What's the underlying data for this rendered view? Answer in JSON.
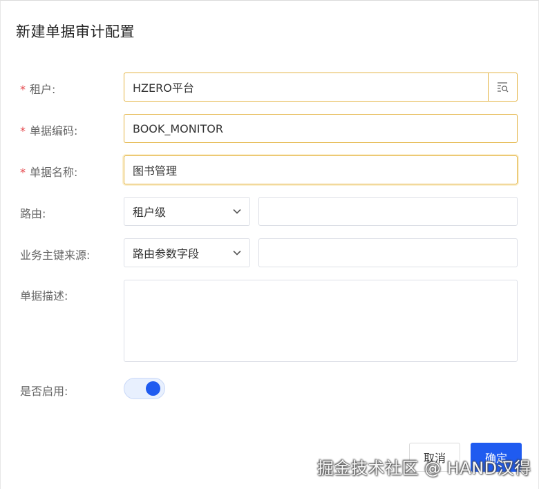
{
  "dialog": {
    "title": "新建单据审计配置",
    "fields": {
      "tenant": {
        "label": "租户:",
        "value": "HZERO平台",
        "required": true
      },
      "doc_code": {
        "label": "单据编码:",
        "value": "BOOK_MONITOR",
        "required": true
      },
      "doc_name": {
        "label": "单据名称:",
        "value": "图书管理",
        "required": true
      },
      "route": {
        "label": "路由:",
        "select_value": "租户级",
        "input_value": ""
      },
      "biz_key_source": {
        "label": "业务主键来源:",
        "select_value": "路由参数字段",
        "input_value": ""
      },
      "description": {
        "label": "单据描述:",
        "value": ""
      },
      "enabled": {
        "label": "是否启用:",
        "on": true
      }
    },
    "buttons": {
      "cancel": "取消",
      "ok": "确定"
    }
  },
  "required_mark": "*",
  "watermark": "掘金技术社区 @ HAND汉得",
  "colors": {
    "accent": "#1f5bf0",
    "required": "#e5484d",
    "focus_border": "#e3b341"
  },
  "icons": {
    "lookup": "lookup-search-icon",
    "chevron": "chevron-down-icon"
  }
}
